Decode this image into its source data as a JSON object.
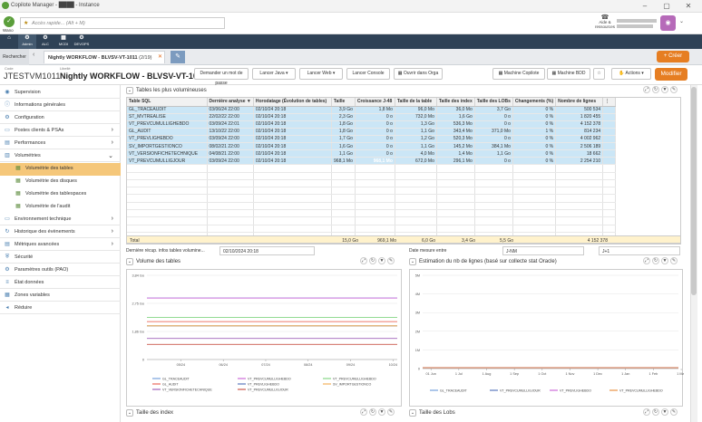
{
  "window": {
    "title": "Copilote Manager - ████ - Instance"
  },
  "topbar": {
    "brand": "Wano",
    "search_placeholder": "Accès rapide... (Alt + M)",
    "help_label": "Aide & ressources"
  },
  "nav": {
    "items": [
      {
        "label": "Accueil",
        "icon": "home-icon"
      },
      {
        "label": "Admin",
        "icon": "admin-icon"
      },
      {
        "label": "ALC",
        "icon": "alc-icon"
      },
      {
        "label": "MCDI",
        "icon": "mcdi-icon"
      },
      {
        "label": "DEVOPS",
        "icon": "devops-icon"
      }
    ]
  },
  "tabs": {
    "search_label": "Rechercher",
    "active_tab": "Nightly WORKFLOW - BLVSV-VT-1011",
    "active_count": "(2/19)"
  },
  "header": {
    "code_label": "Code",
    "code": "JTESTVM1011",
    "name_label": "Libellé",
    "name": "Nightly WORKFLOW - BLVSV-VT-1011",
    "buttons": [
      "Demander un mot de passe",
      "Lancer Java",
      "Lancer Web",
      "Lancer Console",
      "Ouvrir dans Orga",
      "Machine Copilote",
      "Machine BDD",
      "Actions"
    ],
    "modify_label": "Modifier",
    "create_label": "Créer"
  },
  "sidebar": {
    "items": [
      {
        "label": "Supervision",
        "chev": ""
      },
      {
        "label": "Informations générales",
        "chev": ""
      },
      {
        "label": "Configuration",
        "chev": ""
      },
      {
        "label": "Postes clients & PSAs",
        "chev": "›"
      },
      {
        "label": "Performances",
        "chev": "›"
      },
      {
        "label": "Volumétries",
        "chev": "⌄"
      },
      {
        "label": "Volumétrie des tables",
        "sub": true,
        "active": true
      },
      {
        "label": "Volumétrie des disques",
        "sub": true
      },
      {
        "label": "Volumétrie des tablespaces",
        "sub": true
      },
      {
        "label": "Volumétrie de l'audit",
        "sub": true
      },
      {
        "label": "Environnement technique",
        "chev": "›"
      },
      {
        "label": "Historique des évènements",
        "chev": "›"
      },
      {
        "label": "Métriques avancées",
        "chev": "›"
      },
      {
        "label": "Sécurité",
        "chev": ""
      },
      {
        "label": "Paramètres outils (PAO)",
        "chev": ""
      },
      {
        "label": "État données",
        "chev": ""
      },
      {
        "label": "Zones variables",
        "chev": ""
      },
      {
        "label": "Réduire",
        "chev": ""
      }
    ]
  },
  "tables_panel": {
    "title": "Tables les plus volumineuses",
    "columns": [
      "Table SQL",
      "Dernière analyse",
      "Horodatage (Évolution de tables)",
      "Taille",
      "Croissance J-48",
      "Taille de la table",
      "Taille des index",
      "Taille des LOBs",
      "Changements (%)",
      "Nombre de lignes"
    ],
    "rows": [
      [
        "GL_TRACEAUDIT",
        "03/06/24 22:00",
        "02/10/24 20:18",
        "3,9 Go",
        "1,8 Mo",
        "96,0 Mo",
        "36,0 Mo",
        "3,7 Go",
        "0 %",
        "500 534"
      ],
      [
        "ST_MVTREALISE",
        "22/02/22 22:00",
        "02/10/24 20:18",
        "2,3 Go",
        "0 o",
        "732,0 Mo",
        "1,6 Go",
        "0 o",
        "0 %",
        "1 820 455"
      ],
      [
        "VT_PREVCUMULLIGHEBDO",
        "03/09/24 22:01",
        "02/10/24 20:18",
        "1,8 Go",
        "0 o",
        "1,3 Go",
        "536,3 Mo",
        "0 o",
        "0 %",
        "4 152 378"
      ],
      [
        "GL_AUDIT",
        "13/10/22 22:00",
        "02/10/24 20:18",
        "1,8 Go",
        "0 o",
        "1,1 Go",
        "343,4 Mo",
        "371,0 Mo",
        "1 %",
        "814 234"
      ],
      [
        "VT_PREVLIGHEBDO",
        "03/09/24 22:00",
        "02/10/24 20:18",
        "1,7 Go",
        "0 o",
        "1,2 Go",
        "520,3 Mo",
        "0 o",
        "0 %",
        "4 002 962"
      ],
      [
        "SV_IMPORTGESTIONCO",
        "08/02/21 22:00",
        "02/10/24 20:18",
        "1,6 Go",
        "0 o",
        "1,1 Go",
        "145,2 Mo",
        "384,1 Mo",
        "0 %",
        "2 506 189"
      ],
      [
        "VT_VERSIONFICHETECHNIQUE",
        "04/08/21 22:00",
        "02/10/24 20:18",
        "1,1 Go",
        "0 o",
        "4,0 Mo",
        "1,4 Mo",
        "1,1 Go",
        "0 %",
        "18 662"
      ],
      [
        "VT_PREVCUMULLIGJOUR",
        "03/09/24 22:00",
        "02/10/24 20:18",
        "968,1 Mo",
        "968,1 Mo",
        "672,0 Mo",
        "296,1 Mo",
        "0 o",
        "0 %",
        "2 254 210"
      ]
    ],
    "hot_cell": "968,1 Mo",
    "total": {
      "label": "Total",
      "taille": "15,0 Go",
      "croissance": "969,1 Mo",
      "table": "6,0 Go",
      "index": "3,4 Go",
      "lobs": "5,5 Go",
      "lignes": "4 152 378"
    },
    "filters": {
      "last_label": "Dernière récup. infos tables volumine...",
      "last_value": "02/10/2024 20:18",
      "date_label": "Date mesure entre",
      "date_from": "J-NM",
      "date_to": "J+1"
    }
  },
  "volume_chart": {
    "title": "Volume des tables",
    "chart_data": {
      "type": "line",
      "x": [
        "05/24",
        "06/24",
        "07/24",
        "08/24",
        "09/24",
        "10/24"
      ],
      "ylabels": [
        "3,84 Go",
        "2,75 Go",
        "1,86 Go",
        "0"
      ],
      "series": [
        {
          "name": "GL_TRACEAUDIT",
          "color": "#5b8fd6"
        },
        {
          "name": "VT_PREVCUMULLIGHEBDO",
          "color": "#c34fd1"
        },
        {
          "name": "VT_PREVCUMULLIGHEBDO",
          "color": "#6fcf6f"
        },
        {
          "name": "GL_AUDIT",
          "color": "#e74c3c"
        },
        {
          "name": "VT_PREVLIGHEBDO",
          "color": "#3b5fb0"
        },
        {
          "name": "SV_IMPORTGESTIONCO",
          "color": "#f1a33c"
        },
        {
          "name": "VT_VERSIONFICHETECHNIQUE",
          "color": "#8e44ad"
        },
        {
          "name": "VT_PREVCUMULLIGJOUR",
          "color": "#c0392b"
        }
      ]
    }
  },
  "rows_chart": {
    "title": "Estimation du nb de lignes (basé sur collecte stat Oracle)",
    "chart_data": {
      "type": "line",
      "x": [
        "01 Jun",
        "1 Jul",
        "1 Aug",
        "1 Sep",
        "1 Oct",
        "1 Nov",
        "1 Dec",
        "1 Jan",
        "1 Feb",
        "1 Mar"
      ],
      "ylabels": [
        "5M",
        "4M",
        "3M",
        "2M",
        "1M",
        "0"
      ],
      "series": [
        {
          "name": "GL_TRACEAUDIT",
          "color": "#5b8fd6"
        },
        {
          "name": "VT_PREVCUMULLIGJOUR",
          "color": "#3b5fb0"
        },
        {
          "name": "VT_PREVLIGHEBDO",
          "color": "#c34fd1"
        },
        {
          "name": "VT_PREVCUMULLIGHEBDO",
          "color": "#e67e22"
        }
      ]
    }
  },
  "bottom_panels": {
    "index_title": "Taille des index",
    "lobs_title": "Taille des Lobs"
  }
}
